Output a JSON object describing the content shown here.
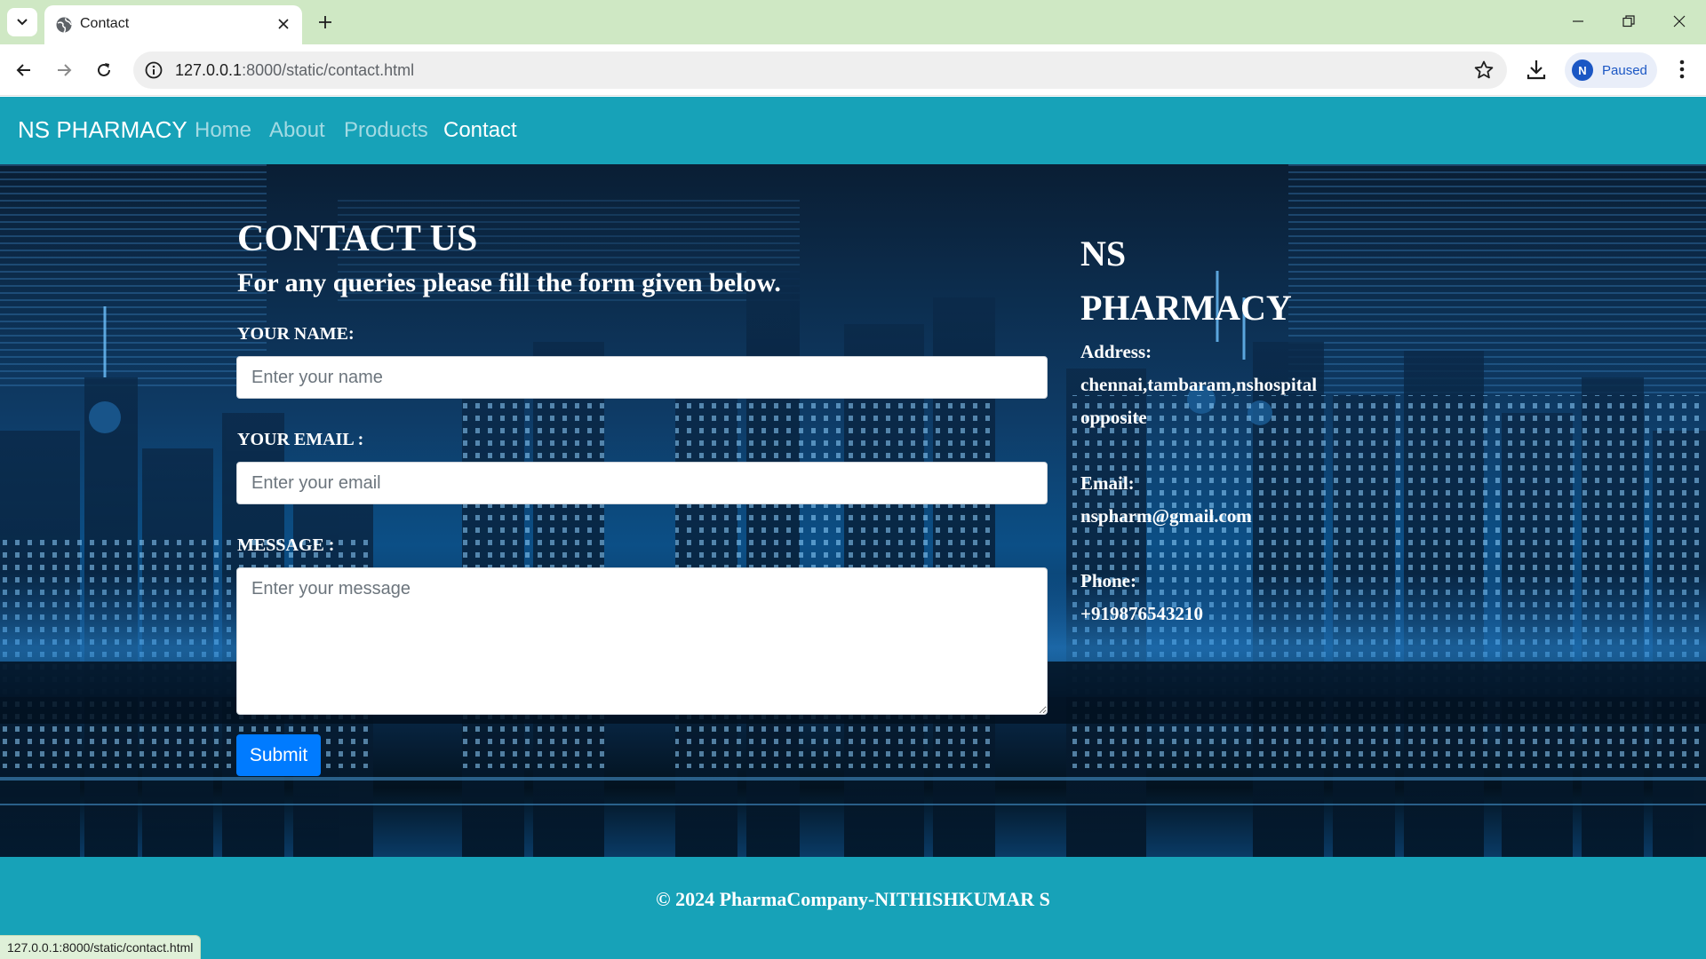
{
  "browser": {
    "tab": {
      "title": "Contact",
      "favicon": "globe-icon"
    },
    "address": {
      "host": "127.0.0.1",
      "path": ":8000/static/contact.html"
    },
    "profile": {
      "initial": "N",
      "label": "Paused"
    },
    "status_url": "127.0.0.1:8000/static/contact.html",
    "icons": {
      "tab_menu": "chevron-down-icon",
      "tab_close": "close-icon",
      "new_tab": "plus-icon",
      "minimize": "minimize-icon",
      "restore": "restore-icon",
      "close_window": "close-icon",
      "back": "back-arrow-icon",
      "forward": "forward-arrow-icon",
      "reload": "reload-icon",
      "site_info": "info-icon",
      "bookmark": "star-icon",
      "downloads": "download-icon",
      "menu": "kebab-menu-icon"
    }
  },
  "navbar": {
    "brand": "NS PHARMACY",
    "links": [
      {
        "label": "Home",
        "active": false
      },
      {
        "label": "About",
        "active": false
      },
      {
        "label": "Products",
        "active": false
      },
      {
        "label": "Contact",
        "active": true
      }
    ]
  },
  "contact": {
    "title": "CONTACT US",
    "subtitle": "For any queries please fill the form given below.",
    "fields": {
      "name": {
        "label": "YOUR NAME:",
        "placeholder": "Enter your name",
        "value": ""
      },
      "email": {
        "label": "YOUR EMAIL :",
        "placeholder": "Enter your email",
        "value": ""
      },
      "message": {
        "label": "MESSAGE :",
        "placeholder": "Enter your message",
        "value": ""
      }
    },
    "submit_label": "Submit"
  },
  "info": {
    "title_line1": "NS",
    "title_line2": "PHARMACY",
    "address_label": "Address:",
    "address_line1": "chennai,tambaram,nshospital",
    "address_line2": "opposite",
    "email_label": "Email:",
    "email_value": "nspharm@gmail.com",
    "phone_label": "Phone:",
    "phone_value": "+919876543210"
  },
  "footer": {
    "text": "© 2024 PharmaCompany-NITHISHKUMAR S"
  },
  "colors": {
    "brand_teal": "#17a2b8",
    "primary_button": "#007bff",
    "tabstrip": "#cfe8c4"
  }
}
